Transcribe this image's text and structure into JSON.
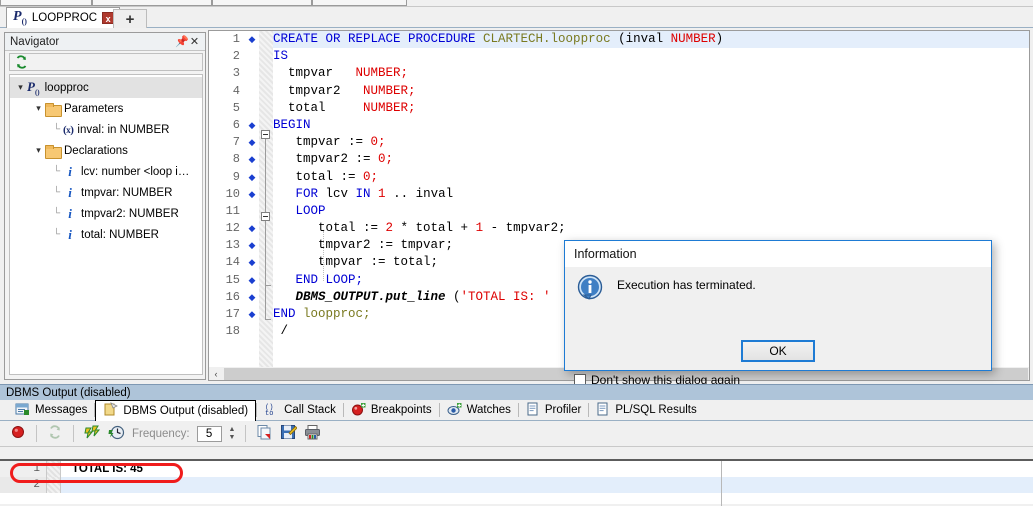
{
  "tabbar": {
    "document_tab": {
      "icon": "procedure-icon",
      "label": "LOOPPROC",
      "close": "x"
    },
    "new_tab_label": "+"
  },
  "navigator": {
    "title": "Navigator",
    "pin_icon": "⎯",
    "close_icon": "✕",
    "refresh_icon": "refresh-icon",
    "tree": [
      {
        "label": "loopproc",
        "icon": "procedure-icon",
        "level": 0,
        "expanded": true,
        "selected": true
      },
      {
        "label": "Parameters",
        "icon": "folder-icon",
        "level": 1,
        "expanded": true
      },
      {
        "label": "inval: in NUMBER",
        "icon": "parameter-icon",
        "level": 2
      },
      {
        "label": "Declarations",
        "icon": "folder-icon",
        "level": 1,
        "expanded": true
      },
      {
        "label": "lcv: number <loop i…",
        "icon": "variable-icon",
        "level": 2
      },
      {
        "label": "tmpvar: NUMBER",
        "icon": "variable-icon",
        "level": 2
      },
      {
        "label": "tmpvar2: NUMBER",
        "icon": "variable-icon",
        "level": 2
      },
      {
        "label": "total: NUMBER",
        "icon": "variable-icon",
        "level": 2
      }
    ]
  },
  "editor": {
    "lines": [
      {
        "n": 1,
        "bp": true,
        "highlight": true,
        "tokens": [
          {
            "t": "CREATE OR REPLACE PROCEDURE ",
            "c": "kw"
          },
          {
            "t": "CLARTECH.loopproc",
            "c": "obj"
          },
          {
            "t": " (inval ",
            "c": "plain"
          },
          {
            "t": "NUMBER",
            "c": "typ"
          },
          {
            "t": ")",
            "c": "plain"
          }
        ]
      },
      {
        "n": 2,
        "bp": false,
        "tokens": [
          {
            "t": "IS",
            "c": "kw"
          }
        ]
      },
      {
        "n": 3,
        "bp": false,
        "tokens": [
          {
            "t": "  tmpvar   ",
            "c": "plain"
          },
          {
            "t": "NUMBER;",
            "c": "typ"
          }
        ]
      },
      {
        "n": 4,
        "bp": false,
        "tokens": [
          {
            "t": "  tmpvar2   ",
            "c": "plain"
          },
          {
            "t": "NUMBER;",
            "c": "typ"
          }
        ]
      },
      {
        "n": 5,
        "bp": false,
        "tokens": [
          {
            "t": "  total     ",
            "c": "plain"
          },
          {
            "t": "NUMBER;",
            "c": "typ"
          }
        ]
      },
      {
        "n": 6,
        "bp": true,
        "tokens": [
          {
            "t": "BEGIN",
            "c": "kw"
          }
        ]
      },
      {
        "n": 7,
        "bp": true,
        "tokens": [
          {
            "t": "   tmpvar := ",
            "c": "plain"
          },
          {
            "t": "0;",
            "c": "typ"
          }
        ]
      },
      {
        "n": 8,
        "bp": true,
        "tokens": [
          {
            "t": "   tmpvar2 := ",
            "c": "plain"
          },
          {
            "t": "0;",
            "c": "typ"
          }
        ]
      },
      {
        "n": 9,
        "bp": true,
        "tokens": [
          {
            "t": "   total := ",
            "c": "plain"
          },
          {
            "t": "0;",
            "c": "typ"
          }
        ]
      },
      {
        "n": 10,
        "bp": true,
        "tokens": [
          {
            "t": "   FOR ",
            "c": "kw"
          },
          {
            "t": "lcv ",
            "c": "plain"
          },
          {
            "t": "IN ",
            "c": "kw"
          },
          {
            "t": "1 ",
            "c": "typ"
          },
          {
            "t": ".. inval",
            "c": "plain"
          }
        ]
      },
      {
        "n": 11,
        "bp": false,
        "tokens": [
          {
            "t": "   LOOP",
            "c": "kw"
          }
        ]
      },
      {
        "n": 12,
        "bp": true,
        "tokens": [
          {
            "t": "      total := ",
            "c": "plain"
          },
          {
            "t": "2",
            "c": "typ"
          },
          {
            "t": " * total + ",
            "c": "plain"
          },
          {
            "t": "1",
            "c": "typ"
          },
          {
            "t": " - tmpvar2;",
            "c": "plain"
          }
        ]
      },
      {
        "n": 13,
        "bp": true,
        "tokens": [
          {
            "t": "      tmpvar2 := tmpvar;",
            "c": "plain"
          }
        ]
      },
      {
        "n": 14,
        "bp": true,
        "tokens": [
          {
            "t": "      tmpvar := total;",
            "c": "plain"
          }
        ]
      },
      {
        "n": 15,
        "bp": true,
        "tokens": [
          {
            "t": "   END LOOP;",
            "c": "kw"
          }
        ]
      },
      {
        "n": 16,
        "bp": true,
        "tokens": [
          {
            "t": "   DBMS_OUTPUT.put_line",
            "c": "ital"
          },
          {
            "t": " (",
            "c": "plain"
          },
          {
            "t": "'TOTAL IS: '",
            "c": "str"
          }
        ]
      },
      {
        "n": 17,
        "bp": true,
        "tokens": [
          {
            "t": "END ",
            "c": "kw"
          },
          {
            "t": "loopproc;",
            "c": "obj"
          }
        ]
      },
      {
        "n": 18,
        "bp": false,
        "tokens": [
          {
            "t": " /",
            "c": "plain"
          }
        ]
      }
    ],
    "hscroll_arrow": "‹"
  },
  "dialog": {
    "title": "Information",
    "icon": "info-icon",
    "message": "Execution has terminated.",
    "ok_label": "OK",
    "checkbox_label": "Don't show this dialog again"
  },
  "log": {
    "panel_title": "DBMS Output (disabled)",
    "tabs": [
      {
        "label": "Messages",
        "icon": "messages-icon",
        "active": false
      },
      {
        "label": "DBMS Output (disabled)",
        "icon": "dbms-output-icon",
        "active": true
      },
      {
        "label": "Call Stack",
        "icon": "call-stack-icon",
        "active": false
      },
      {
        "label": "Breakpoints",
        "icon": "breakpoint-icon",
        "active": false
      },
      {
        "label": "Watches",
        "icon": "watches-icon",
        "active": false
      },
      {
        "label": "Profiler",
        "icon": "profiler-icon",
        "active": false
      },
      {
        "label": "PL/SQL Results",
        "icon": "results-icon",
        "active": false
      }
    ],
    "toolbar": {
      "stop_icon": "stop-icon",
      "refresh_icon": "refresh-icon",
      "enable_icon": "enable-output-icon",
      "timer_icon": "timer-icon",
      "frequency_label": "Frequency:",
      "frequency_value": "5",
      "copy_icon": "copy-icon",
      "save_icon": "save-icon",
      "print_icon": "print-icon"
    }
  },
  "grid": {
    "rows": [
      {
        "num": "1",
        "text": "TOTAL IS: 45",
        "alt": false
      },
      {
        "num": "2",
        "text": "",
        "alt": true
      }
    ]
  },
  "colors": {
    "accent_blue": "#1e7bd4",
    "panel_header": "#aec4d9",
    "keyword": "#0000d4",
    "datatype": "#dd0000",
    "object": "#7a7a20",
    "annotation_red": "#f01c1c"
  }
}
